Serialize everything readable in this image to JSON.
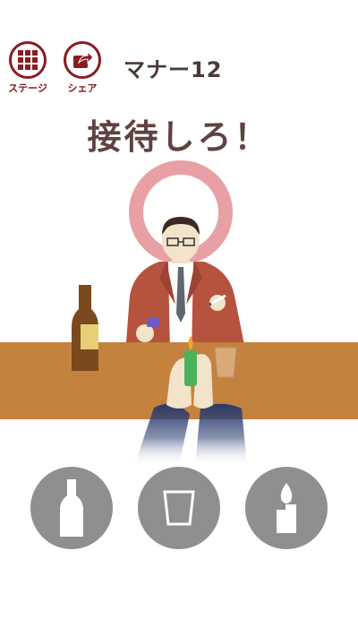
{
  "header": {
    "stage_label": "ステージ",
    "share_label": "シェア",
    "level_title": "マナー12"
  },
  "instruction": "接待しろ！",
  "icons": {
    "stage": "grid-icon",
    "share": "share-icon",
    "bottle": "bottle-icon",
    "glass": "glass-icon",
    "lighter": "lighter-icon"
  },
  "colors": {
    "accent": "#8a1c22",
    "counter": "#c4823f",
    "halo": "#e8a0a5",
    "jacket": "#b5533f",
    "action_button": "#8f8f8f"
  },
  "actions": [
    {
      "name": "bottle"
    },
    {
      "name": "glass"
    },
    {
      "name": "lighter"
    }
  ]
}
